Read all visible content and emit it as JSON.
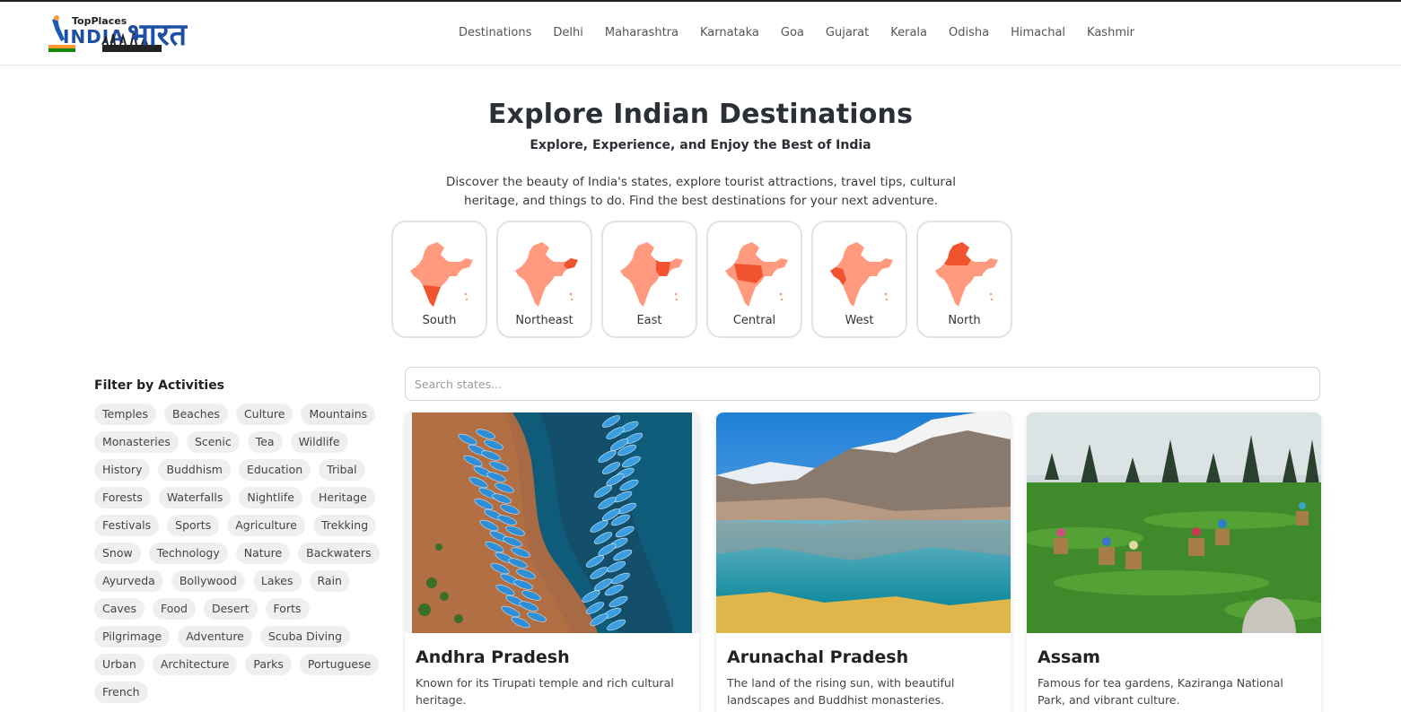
{
  "header": {
    "logo": {
      "top_text": "TopPlaces",
      "main_text": "INDIA",
      "hindi_text": "भारत"
    },
    "nav": [
      "Destinations",
      "Delhi",
      "Maharashtra",
      "Karnataka",
      "Goa",
      "Gujarat",
      "Kerala",
      "Odisha",
      "Himachal",
      "Kashmir"
    ]
  },
  "hero": {
    "title": "Explore Indian Destinations",
    "subtitle": "Explore, Experience, and Enjoy the Best of India",
    "description": "Discover the beauty of India's states, explore tourist attractions, travel tips, cultural heritage, and things to do. Find the best destinations for your next adventure."
  },
  "regions": [
    {
      "label": "South",
      "icon": "india-map-south-icon"
    },
    {
      "label": "Northeast",
      "icon": "india-map-northeast-icon"
    },
    {
      "label": "East",
      "icon": "india-map-east-icon"
    },
    {
      "label": "Central",
      "icon": "india-map-central-icon"
    },
    {
      "label": "West",
      "icon": "india-map-west-icon"
    },
    {
      "label": "North",
      "icon": "india-map-north-icon"
    }
  ],
  "colors": {
    "map_base": "#ff9a7f",
    "map_highlight": "#f2532f",
    "chip_bg": "#efefef"
  },
  "filters": {
    "title": "Filter by Activities",
    "chips": [
      "Temples",
      "Beaches",
      "Culture",
      "Mountains",
      "Monasteries",
      "Scenic",
      "Tea",
      "Wildlife",
      "History",
      "Buddhism",
      "Education",
      "Tribal",
      "Forests",
      "Waterfalls",
      "Nightlife",
      "Heritage",
      "Festivals",
      "Sports",
      "Agriculture",
      "Trekking",
      "Snow",
      "Technology",
      "Nature",
      "Backwaters",
      "Ayurveda",
      "Bollywood",
      "Lakes",
      "Rain",
      "Caves",
      "Food",
      "Desert",
      "Forts",
      "Pilgrimage",
      "Adventure",
      "Scuba Diving",
      "Urban",
      "Architecture",
      "Parks",
      "Portuguese",
      "French"
    ]
  },
  "search": {
    "placeholder": "Search states..."
  },
  "cards": [
    {
      "title": "Andhra Pradesh",
      "description": "Known for its Tirupati temple and rich cultural heritage."
    },
    {
      "title": "Arunachal Pradesh",
      "description": "The land of the rising sun, with beautiful landscapes and Buddhist monasteries."
    },
    {
      "title": "Assam",
      "description": "Famous for tea gardens, Kaziranga National Park, and vibrant culture."
    }
  ]
}
